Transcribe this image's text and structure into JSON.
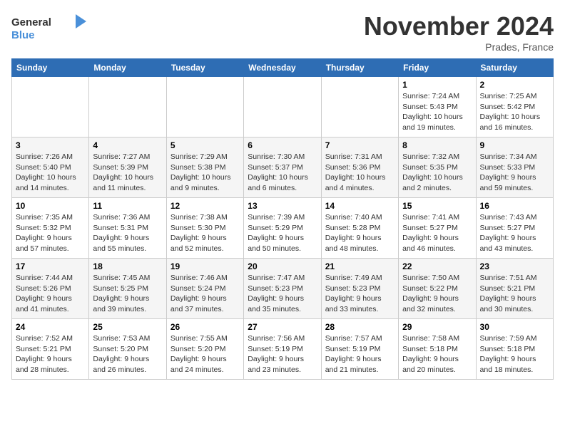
{
  "logo": {
    "line1": "General",
    "line2": "Blue"
  },
  "header": {
    "month": "November 2024",
    "location": "Prades, France"
  },
  "days_of_week": [
    "Sunday",
    "Monday",
    "Tuesday",
    "Wednesday",
    "Thursday",
    "Friday",
    "Saturday"
  ],
  "weeks": [
    [
      {
        "day": "",
        "detail": ""
      },
      {
        "day": "",
        "detail": ""
      },
      {
        "day": "",
        "detail": ""
      },
      {
        "day": "",
        "detail": ""
      },
      {
        "day": "",
        "detail": ""
      },
      {
        "day": "1",
        "detail": "Sunrise: 7:24 AM\nSunset: 5:43 PM\nDaylight: 10 hours and 19 minutes."
      },
      {
        "day": "2",
        "detail": "Sunrise: 7:25 AM\nSunset: 5:42 PM\nDaylight: 10 hours and 16 minutes."
      }
    ],
    [
      {
        "day": "3",
        "detail": "Sunrise: 7:26 AM\nSunset: 5:40 PM\nDaylight: 10 hours and 14 minutes."
      },
      {
        "day": "4",
        "detail": "Sunrise: 7:27 AM\nSunset: 5:39 PM\nDaylight: 10 hours and 11 minutes."
      },
      {
        "day": "5",
        "detail": "Sunrise: 7:29 AM\nSunset: 5:38 PM\nDaylight: 10 hours and 9 minutes."
      },
      {
        "day": "6",
        "detail": "Sunrise: 7:30 AM\nSunset: 5:37 PM\nDaylight: 10 hours and 6 minutes."
      },
      {
        "day": "7",
        "detail": "Sunrise: 7:31 AM\nSunset: 5:36 PM\nDaylight: 10 hours and 4 minutes."
      },
      {
        "day": "8",
        "detail": "Sunrise: 7:32 AM\nSunset: 5:35 PM\nDaylight: 10 hours and 2 minutes."
      },
      {
        "day": "9",
        "detail": "Sunrise: 7:34 AM\nSunset: 5:33 PM\nDaylight: 9 hours and 59 minutes."
      }
    ],
    [
      {
        "day": "10",
        "detail": "Sunrise: 7:35 AM\nSunset: 5:32 PM\nDaylight: 9 hours and 57 minutes."
      },
      {
        "day": "11",
        "detail": "Sunrise: 7:36 AM\nSunset: 5:31 PM\nDaylight: 9 hours and 55 minutes."
      },
      {
        "day": "12",
        "detail": "Sunrise: 7:38 AM\nSunset: 5:30 PM\nDaylight: 9 hours and 52 minutes."
      },
      {
        "day": "13",
        "detail": "Sunrise: 7:39 AM\nSunset: 5:29 PM\nDaylight: 9 hours and 50 minutes."
      },
      {
        "day": "14",
        "detail": "Sunrise: 7:40 AM\nSunset: 5:28 PM\nDaylight: 9 hours and 48 minutes."
      },
      {
        "day": "15",
        "detail": "Sunrise: 7:41 AM\nSunset: 5:27 PM\nDaylight: 9 hours and 46 minutes."
      },
      {
        "day": "16",
        "detail": "Sunrise: 7:43 AM\nSunset: 5:27 PM\nDaylight: 9 hours and 43 minutes."
      }
    ],
    [
      {
        "day": "17",
        "detail": "Sunrise: 7:44 AM\nSunset: 5:26 PM\nDaylight: 9 hours and 41 minutes."
      },
      {
        "day": "18",
        "detail": "Sunrise: 7:45 AM\nSunset: 5:25 PM\nDaylight: 9 hours and 39 minutes."
      },
      {
        "day": "19",
        "detail": "Sunrise: 7:46 AM\nSunset: 5:24 PM\nDaylight: 9 hours and 37 minutes."
      },
      {
        "day": "20",
        "detail": "Sunrise: 7:47 AM\nSunset: 5:23 PM\nDaylight: 9 hours and 35 minutes."
      },
      {
        "day": "21",
        "detail": "Sunrise: 7:49 AM\nSunset: 5:23 PM\nDaylight: 9 hours and 33 minutes."
      },
      {
        "day": "22",
        "detail": "Sunrise: 7:50 AM\nSunset: 5:22 PM\nDaylight: 9 hours and 32 minutes."
      },
      {
        "day": "23",
        "detail": "Sunrise: 7:51 AM\nSunset: 5:21 PM\nDaylight: 9 hours and 30 minutes."
      }
    ],
    [
      {
        "day": "24",
        "detail": "Sunrise: 7:52 AM\nSunset: 5:21 PM\nDaylight: 9 hours and 28 minutes."
      },
      {
        "day": "25",
        "detail": "Sunrise: 7:53 AM\nSunset: 5:20 PM\nDaylight: 9 hours and 26 minutes."
      },
      {
        "day": "26",
        "detail": "Sunrise: 7:55 AM\nSunset: 5:20 PM\nDaylight: 9 hours and 24 minutes."
      },
      {
        "day": "27",
        "detail": "Sunrise: 7:56 AM\nSunset: 5:19 PM\nDaylight: 9 hours and 23 minutes."
      },
      {
        "day": "28",
        "detail": "Sunrise: 7:57 AM\nSunset: 5:19 PM\nDaylight: 9 hours and 21 minutes."
      },
      {
        "day": "29",
        "detail": "Sunrise: 7:58 AM\nSunset: 5:18 PM\nDaylight: 9 hours and 20 minutes."
      },
      {
        "day": "30",
        "detail": "Sunrise: 7:59 AM\nSunset: 5:18 PM\nDaylight: 9 hours and 18 minutes."
      }
    ]
  ]
}
